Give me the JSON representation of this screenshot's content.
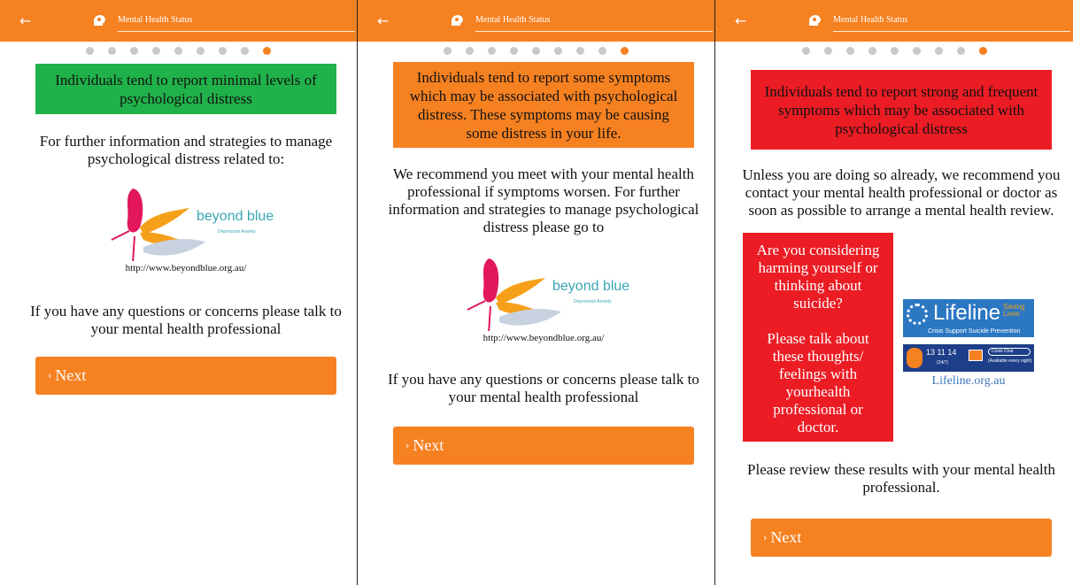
{
  "app": {
    "title": "Mental Health Status"
  },
  "progress": {
    "total": 9,
    "active_index": 8
  },
  "colors": {
    "header": "#f68121",
    "next_button": "#f68121",
    "minimal": "#20b24a",
    "some": "#f68121",
    "strong": "#ec1c24"
  },
  "icons": {
    "back": "arrow-left-icon",
    "header": "head-brain-icon"
  },
  "beyondblue": {
    "logo_name": "beyond blue",
    "logo_tagline": "Depression Anxiety",
    "url": "http://www.beyondblue.org.au/"
  },
  "lifeline": {
    "name": "Lifeline",
    "saving_lives": "Saving Lives",
    "tagline": "Crisis Support Suicide Prevention",
    "phone": "13 11 14",
    "hours": "(24/7)",
    "crisis_chat": "Crisis Chat",
    "availability": "(Available every night)",
    "link": "Lifeline.org.au"
  },
  "panels": [
    {
      "banner": "Individuals tend to report minimal levels of psychological distress",
      "info": "For further information and strategies to manage psychological distress related to:",
      "questions": "If you have any questions or concerns please talk to your mental health professional",
      "next": "Next"
    },
    {
      "banner": "Individuals tend to report some symptoms which may be associated with psychological distress. These symptoms may be causing some distress in your life.",
      "recommend": "We recommend you meet with your mental health professional if symptoms worsen. For further information and strategies to manage psychological distress please go to",
      "questions": "If you have any questions or concerns please talk to your mental health professional",
      "next": "Next"
    },
    {
      "banner": "Individuals tend to report strong and frequent symptoms which may be associated with psychological distress",
      "recommend": "Unless you are doing so already, we recommend you contact your mental health professional or doctor as soon as possible to arrange a mental health review.",
      "warning_question": "Are you considering harming yourself or thinking about suicide?",
      "warning_advice": "Please talk about these thoughts/ feelings with yourhealth professional or doctor.",
      "review": "Please review these results with your mental health professional.",
      "next": "Next"
    }
  ]
}
